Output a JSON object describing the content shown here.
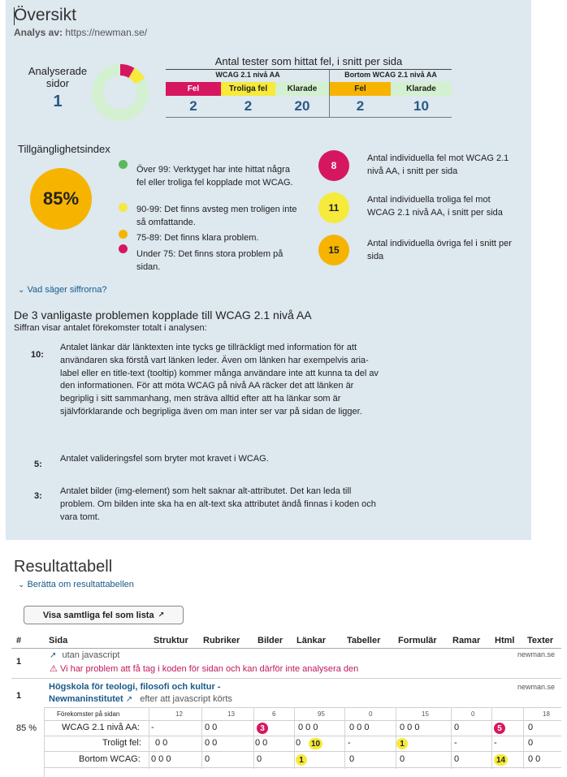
{
  "overview": {
    "title": "Översikt",
    "analysis_by_label": "Analys av:",
    "analysis_url": "https://newman.se/",
    "analyzed_pages_label": "Analyserade sidor",
    "analyzed_pages_count": "1",
    "tests_title": "Antal tester som hittat fel, i snitt per sida",
    "group_wcag": "WCAG 2.1 nivå AA",
    "group_beyond": "Bortom WCAG 2.1 nivå AA",
    "col_fel": "Fel",
    "col_troliga": "Troliga fel",
    "col_klarade": "Klarade",
    "col_fel2": "Fel",
    "col_klarade2": "Klarade",
    "val_fel": "2",
    "val_troliga": "2",
    "val_klarade": "20",
    "val_fel2": "2",
    "val_klarade2": "10",
    "index_title": "Tillgänglighetsindex",
    "index_value": "85%",
    "legend": [
      {
        "text": "Över 99: Verktyget har inte hittat några fel eller troliga fel kopplade mot WCAG.",
        "color": "#5cb85c"
      },
      {
        "text": "90-99: Det finns avsteg men troligen inte så omfattande.",
        "color": "#f4e842"
      },
      {
        "text": "75-89: Det finns klara problem.",
        "color": "#f6b400"
      },
      {
        "text": "Under 75: Det finns stora problem på sidan.",
        "color": "#d6175f"
      }
    ],
    "counts": [
      {
        "value": "8",
        "text": "Antal individuella fel mot WCAG 2.1 nivå AA, i snitt per sida",
        "color": "#d6175f",
        "textcolor": "#ffffff"
      },
      {
        "value": "11",
        "text": "Antal individuella troliga fel mot WCAG 2.1 nivå AA, i snitt per sida",
        "color": "#f6ea3a",
        "textcolor": "#222222"
      },
      {
        "value": "15",
        "text": "Antal individuella övriga fel i snitt per sida",
        "color": "#f6b400",
        "textcolor": "#222222"
      }
    ],
    "what_numbers_link": "Vad säger siffrorna?",
    "top_title": "De 3 vanligaste problemen kopplade till WCAG 2.1 nivå AA",
    "top_subtitle": "Siffran visar antalet förekomster totalt i analysen:",
    "problems": [
      {
        "count": "10:",
        "text": "Antalet länkar där länktexten inte tycks ge tillräckligt med information för att användaren ska förstå vart länken leder. Även om länken har exempelvis aria-label eller en title-text (tooltip) kommer många användare inte att kunna ta del av den informationen. För att möta WCAG på nivå AA räcker det att länken är begriplig i sitt sammanhang, men sträva alltid efter att ha länkar som är självförklarande och begripliga även om man inter ser var på sidan de ligger."
      },
      {
        "count": "5:",
        "text": "Antalet valideringsfel som bryter mot kravet i WCAG."
      },
      {
        "count": "3:",
        "text": "Antalet bilder (img-element) som helt saknar alt-attributet. Det kan leda till problem. Om bilden inte ska ha en alt-text ska attributet ändå finnas i koden och vara tomt."
      }
    ]
  },
  "donut": {
    "fel": 2,
    "troliga": 2,
    "klarade": 20,
    "colors": {
      "fel": "#d6175f",
      "troliga": "#f6ea3a",
      "klarade": "#d3f0d0"
    }
  },
  "results": {
    "title": "Resultattabell",
    "about_link": "Berätta om resultattabellen",
    "show_all_button": "Visa samtliga fel som lista",
    "headers": [
      "#",
      "Sida",
      "Struktur",
      "Rubriker",
      "Bilder",
      "Länkar",
      "Tabeller",
      "Formulär",
      "Ramar",
      "Html",
      "Texter"
    ],
    "row1": {
      "num": "1",
      "page": "utan javascript",
      "domain": "newman.se",
      "error": "Vi har problem att få tag i koden för sidan och kan därför inte analysera den"
    },
    "row2": {
      "num": "1",
      "page_link_1": "Högskola för teologi, filosofi och kultur -",
      "page_link_2": "Newmaninstitutet",
      "page_note": "efter att javascript körts",
      "domain": "newman.se"
    },
    "occurrences_label": "Förekomster på sidan",
    "occurrences": [
      "12",
      "13",
      "6",
      "95",
      "0",
      "15",
      "0",
      "",
      "18"
    ],
    "score": "85 %",
    "line_wcag": "WCAG 2.1 nivå AA:",
    "line_troliga": "Troligt fel:",
    "line_bortom": "Bortom WCAG:",
    "wcag_cells": [
      "-",
      "0 0",
      "3",
      "0 0 0",
      "0 0 0",
      "0 0 0",
      "0",
      "5",
      "0"
    ],
    "troliga_cells": [
      "0 0",
      "0 0",
      "0 0",
      "0",
      "10",
      "-",
      "1",
      "-",
      "-",
      "0"
    ],
    "bortom_cells": [
      "0 0 0",
      "0",
      "0",
      "1",
      "0",
      "0",
      "0",
      "14",
      "0 0"
    ]
  }
}
